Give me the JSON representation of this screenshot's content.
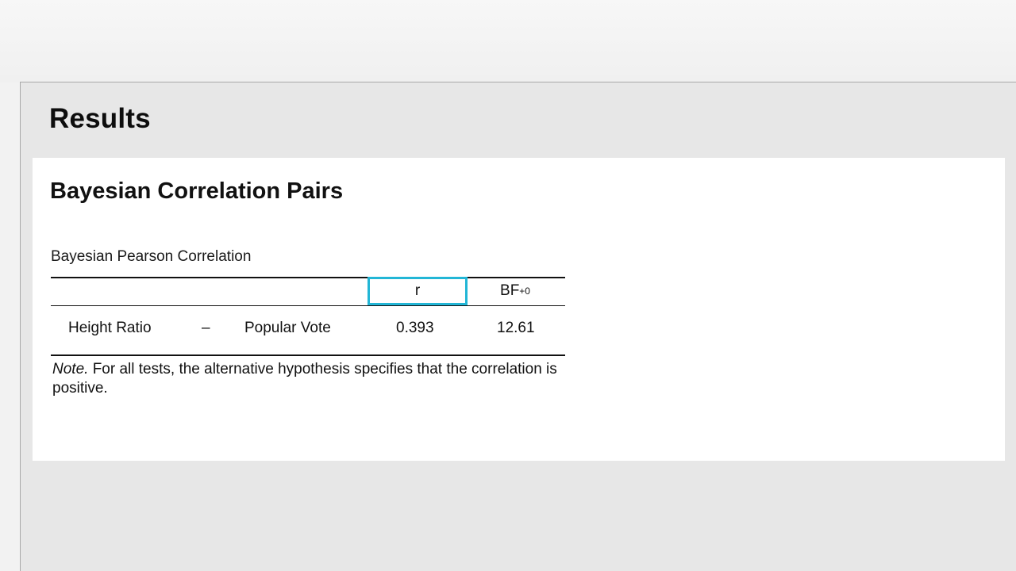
{
  "results": {
    "title": "Results"
  },
  "analysis": {
    "title": "Bayesian Correlation Pairs",
    "table": {
      "caption": "Bayesian Pearson Correlation",
      "headers": {
        "r": "r",
        "bf_main": "BF",
        "bf_sub": "+0"
      },
      "rows": [
        {
          "var1": "Height Ratio",
          "separator": "–",
          "var2": "Popular Vote",
          "r": "0.393",
          "bf": "12.61"
        }
      ],
      "note_label": "Note.",
      "note_text": " For all tests, the alternative hypothesis specifies that the correlation is positive."
    }
  },
  "colors": {
    "selection_border": "#22b6d6",
    "pane_background": "#e7e7e7",
    "card_background": "#ffffff"
  }
}
